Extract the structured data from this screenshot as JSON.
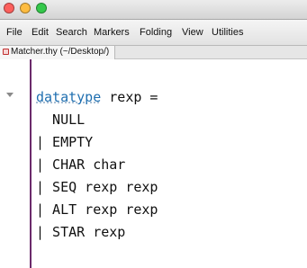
{
  "window": {
    "traffic_lights": [
      {
        "name": "close",
        "color": "#fc605c"
      },
      {
        "name": "minimize",
        "color": "#fdbc40"
      },
      {
        "name": "zoom",
        "color": "#34c84a"
      }
    ]
  },
  "menubar": {
    "items": [
      "File",
      "Edit",
      "Search",
      "Markers",
      "Folding",
      "View",
      "Utilities"
    ]
  },
  "tabs": [
    {
      "label": "Matcher.thy (~/Desktop/)",
      "icon": "file-modified-icon"
    }
  ],
  "editor": {
    "keyword_color": "#1f6fb0",
    "gutter_line_color": "#6b2a6b",
    "lines": [
      {
        "keyword": "datatype",
        "rest": " rexp ="
      },
      {
        "text": "  NULL"
      },
      {
        "text": "| EMPTY"
      },
      {
        "text": "| CHAR char"
      },
      {
        "text": "| SEQ rexp rexp"
      },
      {
        "text": "| ALT rexp rexp"
      },
      {
        "text": "| STAR rexp"
      }
    ]
  }
}
